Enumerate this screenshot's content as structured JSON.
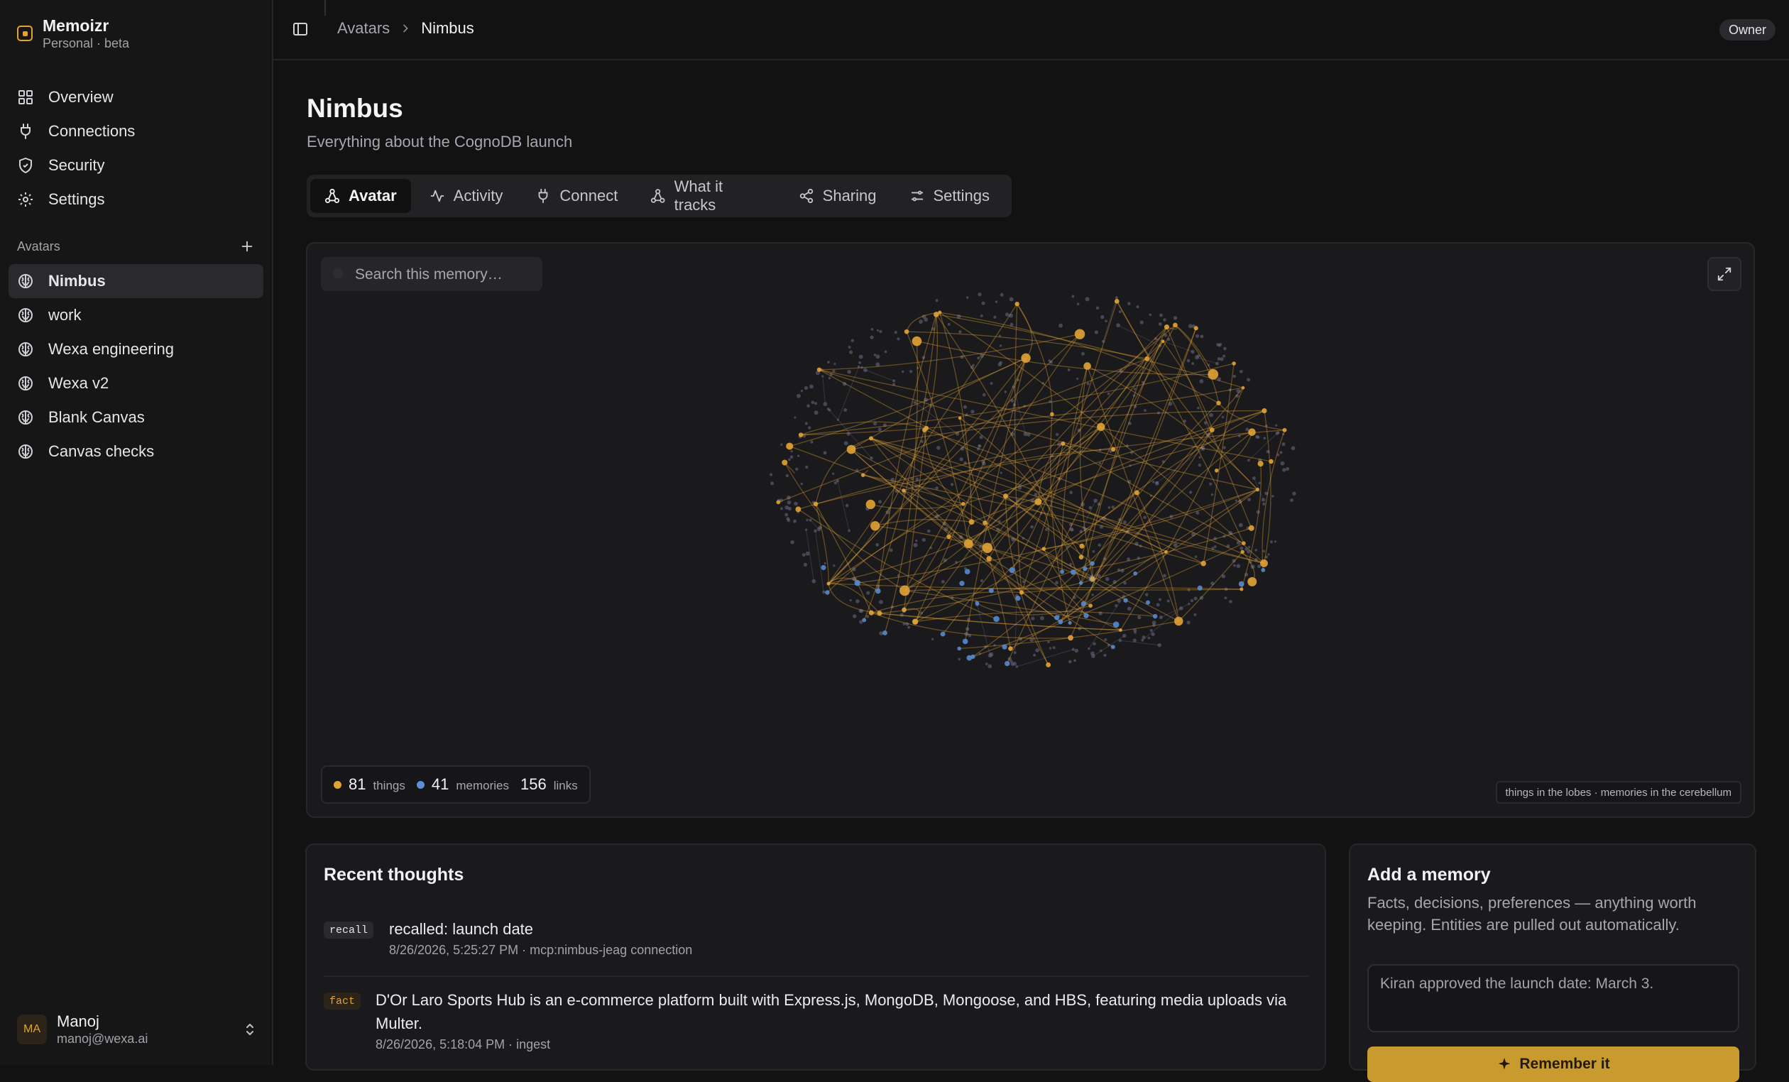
{
  "app": {
    "name": "Memoizr",
    "workspace": "Personal · beta"
  },
  "sidebar": {
    "nav": [
      {
        "label": "Overview",
        "icon": "grid-icon"
      },
      {
        "label": "Connections",
        "icon": "plug-icon"
      },
      {
        "label": "Security",
        "icon": "shield-icon"
      },
      {
        "label": "Settings",
        "icon": "gear-icon"
      }
    ],
    "avatars_heading": "Avatars",
    "avatars": [
      {
        "label": "Nimbus",
        "active": true
      },
      {
        "label": "work"
      },
      {
        "label": "Wexa engineering"
      },
      {
        "label": "Wexa v2"
      },
      {
        "label": "Blank Canvas"
      },
      {
        "label": "Canvas checks"
      }
    ],
    "user": {
      "initials": "MA",
      "name": "Manoj",
      "email": "manoj@wexa.ai"
    }
  },
  "topbar": {
    "breadcrumb": [
      "Avatars",
      "Nimbus"
    ],
    "role": "Owner"
  },
  "page": {
    "title": "Nimbus",
    "subtitle": "Everything about the CognoDB launch"
  },
  "tabs": [
    {
      "label": "Avatar",
      "icon": "nodes-icon",
      "active": true
    },
    {
      "label": "Activity",
      "icon": "activity-icon"
    },
    {
      "label": "Connect",
      "icon": "plug-icon"
    },
    {
      "label": "What it tracks",
      "icon": "nodes-icon"
    },
    {
      "label": "Sharing",
      "icon": "share-icon"
    },
    {
      "label": "Settings",
      "icon": "sliders-icon"
    }
  ],
  "graph": {
    "search_placeholder": "Search this memory…",
    "stats": {
      "things_count": "81",
      "things_label": "things",
      "memories_count": "41",
      "memories_label": "memories",
      "links_count": "156",
      "links_label": "links"
    },
    "legend_hint": "things in the lobes · memories in the cerebellum",
    "colors": {
      "thing": "#e2a335",
      "memory": "#5b8fd9",
      "faint_node": "#6d6b86"
    }
  },
  "recent": {
    "title": "Recent thoughts",
    "items": [
      {
        "tag": "recall",
        "text": "recalled: launch date",
        "meta": "8/26/2026, 5:25:27 PM · mcp:nimbus-jeag connection"
      },
      {
        "tag": "fact",
        "text": "D'Or Laro Sports Hub is an e-commerce platform built with Express.js, MongoDB, Mongoose, and HBS, featuring media uploads via Multer.",
        "meta": "8/26/2026, 5:18:04 PM · ingest"
      }
    ]
  },
  "add_memory": {
    "title": "Add a memory",
    "description": "Facts, decisions, preferences — anything worth keeping. Entities are pulled out automatically.",
    "placeholder": "Kiran approved the launch date: March 3.",
    "button": "Remember it"
  },
  "theme": {
    "accent": "#e2a335",
    "background": "#121213",
    "panel": "#1a1a1c"
  }
}
